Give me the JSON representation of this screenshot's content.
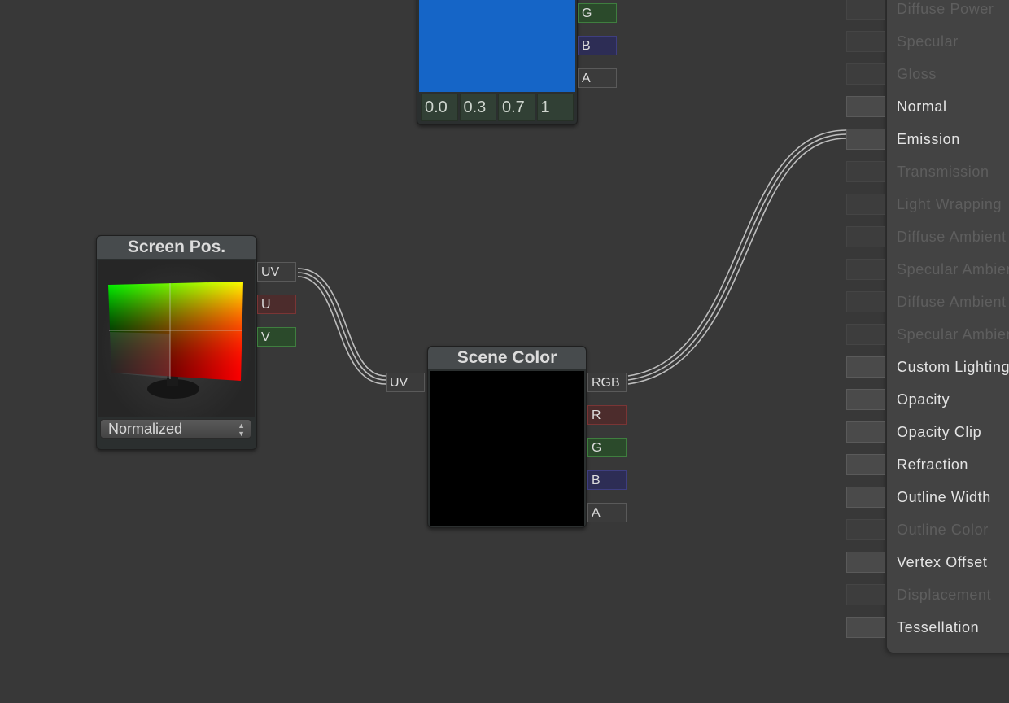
{
  "color_node": {
    "swatch_color": "#1565c7",
    "outputs": [
      "G",
      "B",
      "A"
    ],
    "values": [
      "0.0",
      "0.3",
      "0.7",
      "1"
    ]
  },
  "screen_pos_node": {
    "title": "Screen Pos.",
    "outputs": [
      "UV",
      "U",
      "V"
    ],
    "mode": "Normalized"
  },
  "scene_color_node": {
    "title": "Scene Color",
    "input": "UV",
    "outputs": [
      "RGB",
      "R",
      "G",
      "B",
      "A"
    ]
  },
  "master_node": {
    "inputs": [
      {
        "label": "Diffuse Power",
        "enabled": false
      },
      {
        "label": "Specular",
        "enabled": false
      },
      {
        "label": "Gloss",
        "enabled": false
      },
      {
        "label": "Normal",
        "enabled": true
      },
      {
        "label": "Emission",
        "enabled": true
      },
      {
        "label": "Transmission",
        "enabled": false
      },
      {
        "label": "Light Wrapping",
        "enabled": false
      },
      {
        "label": "Diffuse Ambient",
        "enabled": false
      },
      {
        "label": "Specular Ambient",
        "enabled": false
      },
      {
        "label": "Diffuse Ambient",
        "enabled": false
      },
      {
        "label": "Specular Ambient",
        "enabled": false
      },
      {
        "label": "Custom Lighting",
        "enabled": true
      },
      {
        "label": "Opacity",
        "enabled": true
      },
      {
        "label": "Opacity Clip",
        "enabled": true
      },
      {
        "label": "Refraction",
        "enabled": true
      },
      {
        "label": "Outline Width",
        "enabled": true
      },
      {
        "label": "Outline Color",
        "enabled": false
      },
      {
        "label": "Vertex Offset",
        "enabled": true
      },
      {
        "label": "Displacement",
        "enabled": false
      },
      {
        "label": "Tessellation",
        "enabled": true
      }
    ]
  }
}
